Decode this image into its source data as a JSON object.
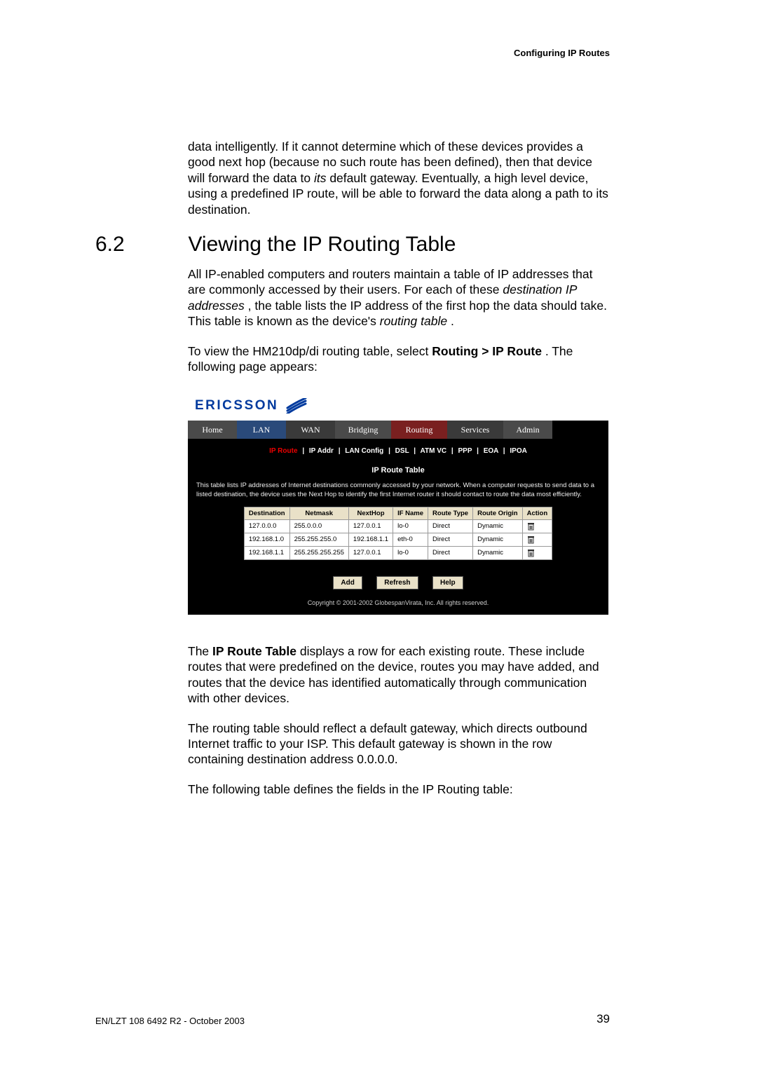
{
  "runningHead": "Configuring IP Routes",
  "introPara_before": "data intelligently. If it cannot determine which of these devices provides a good next hop (because no such route has been defined), then that device will forward the data to ",
  "introPara_its": "its",
  "introPara_after": " default gateway. Eventually, a high level device, using a predefined IP route, will be able to forward the data along a path to its destination.",
  "h2num": "6.2",
  "h2title": "Viewing the IP Routing Table",
  "p2_a": "All IP-enabled computers and routers maintain a table of IP addresses that are commonly accessed by their users. For each of these ",
  "p2_b": "destination IP addresses",
  "p2_c": ", the table lists the IP address of the first hop the data should take. This table is known as the device's ",
  "p2_d": "routing table",
  "p2_e": ".",
  "p3_a": "To view the HM210dp/di routing table, select ",
  "p3_b": "Routing > IP Route",
  "p3_c": ". The following page appears:",
  "brand": "ERICSSON",
  "navItems": [
    "Home",
    "LAN",
    "WAN",
    "Bridging",
    "Routing",
    "Services",
    "Admin"
  ],
  "subNavActive": "IP Route",
  "subNavItems": [
    "IP Addr",
    "LAN Config",
    "DSL",
    "ATM VC",
    "PPP",
    "EOA",
    "IPOA"
  ],
  "rtTitle": "IP Route Table",
  "rtDesc": "This table lists IP addresses of Internet destinations commonly accessed by your network. When a computer requests to send data to a listed destination, the device uses the Next Hop to identify the first Internet router it should contact to route the data most efficiently.",
  "tableHeaders": [
    "Destination",
    "Netmask",
    "NextHop",
    "IF Name",
    "Route Type",
    "Route Origin",
    "Action"
  ],
  "tableRows": [
    {
      "c0": "127.0.0.0",
      "c1": "255.0.0.0",
      "c2": "127.0.0.1",
      "c3": "lo-0",
      "c4": "Direct",
      "c5": "Dynamic"
    },
    {
      "c0": "192.168.1.0",
      "c1": "255.255.255.0",
      "c2": "192.168.1.1",
      "c3": "eth-0",
      "c4": "Direct",
      "c5": "Dynamic"
    },
    {
      "c0": "192.168.1.1",
      "c1": "255.255.255.255",
      "c2": "127.0.0.1",
      "c3": "lo-0",
      "c4": "Direct",
      "c5": "Dynamic"
    }
  ],
  "btnAdd": "Add",
  "btnRefresh": "Refresh",
  "btnHelp": "Help",
  "copyright": "Copyright © 2001-2002 GlobespanVirata, Inc. All rights reserved.",
  "p4_a": "The ",
  "p4_b": "IP Route Table",
  "p4_c": " displays a row for each existing route. These include routes that were predefined on the device, routes you may have added, and routes that the device has identified automatically through communication with other devices.",
  "p5": "The routing table should reflect a default gateway, which directs outbound Internet traffic to your ISP. This default gateway is shown in the row containing destination address 0.0.0.0.",
  "p6": "The following table defines the fields in the IP Routing table:",
  "footerLeft": "EN/LZT 108 6492 R2 - October 2003",
  "footerRight": "39"
}
